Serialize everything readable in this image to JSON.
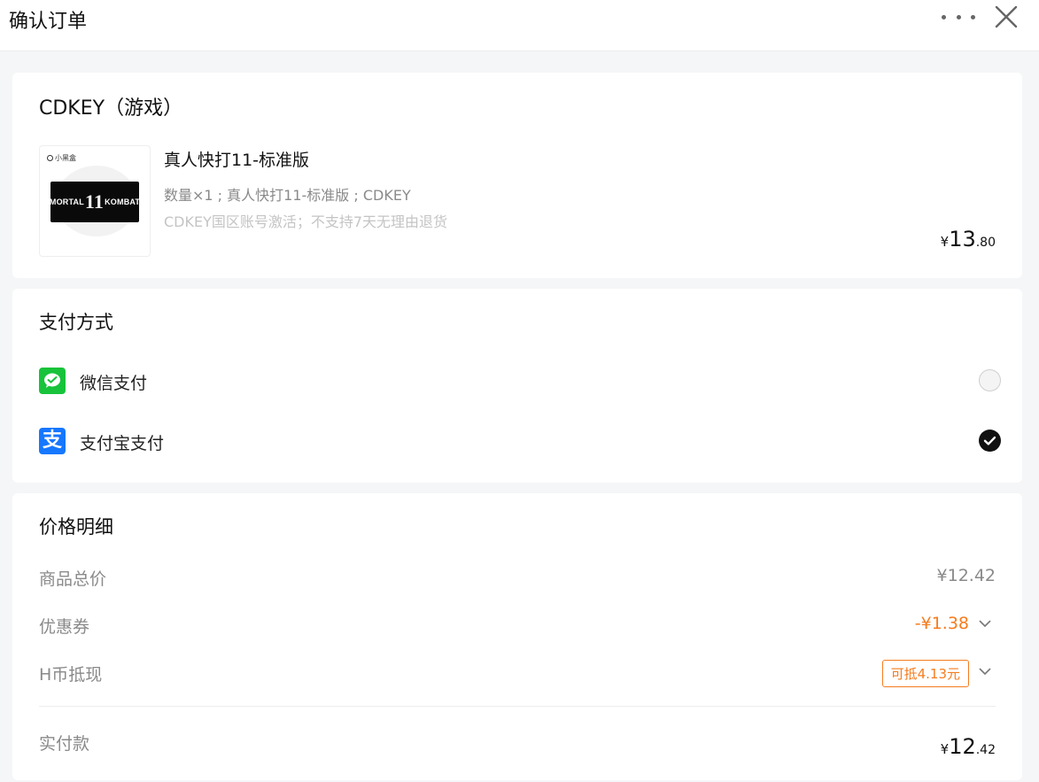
{
  "header": {
    "title": "确认订单",
    "more_icon": "more-dots-icon",
    "close_icon": "close-icon"
  },
  "product": {
    "category": "CDKEY（游戏）",
    "thumbnail": {
      "brand_text": "小黑盒",
      "logo_left": "MORTAL",
      "logo_num": "11",
      "logo_right": "KOMBAT"
    },
    "name": "真人快打11-标准版",
    "spec": "数量×1 ; 真人快打11-标准版 ; CDKEY",
    "note": "CDKEY国区账号激活；不支持7天无理由退货",
    "price": {
      "symbol": "¥",
      "integer": "13",
      "decimal": ".80"
    }
  },
  "payment": {
    "title": "支付方式",
    "methods": [
      {
        "label": "微信支付",
        "icon": "wechat-pay-icon",
        "selected": false
      },
      {
        "label": "支付宝支付",
        "icon": "alipay-icon",
        "icon_glyph": "支",
        "selected": true
      }
    ]
  },
  "price_detail": {
    "title": "价格明细",
    "goods_total": {
      "label": "商品总价",
      "value": "¥12.42"
    },
    "coupon": {
      "label": "优惠券",
      "value": "-¥1.38"
    },
    "hcoin": {
      "label": "H币抵现",
      "badge": "可抵4.13元"
    },
    "paid": {
      "label": "实付款",
      "symbol": "¥",
      "integer": "12",
      "decimal": ".42"
    }
  },
  "colors": {
    "accent_orange": "#f57c1f",
    "wechat_green": "#17c33a",
    "alipay_blue": "#1677ff"
  }
}
